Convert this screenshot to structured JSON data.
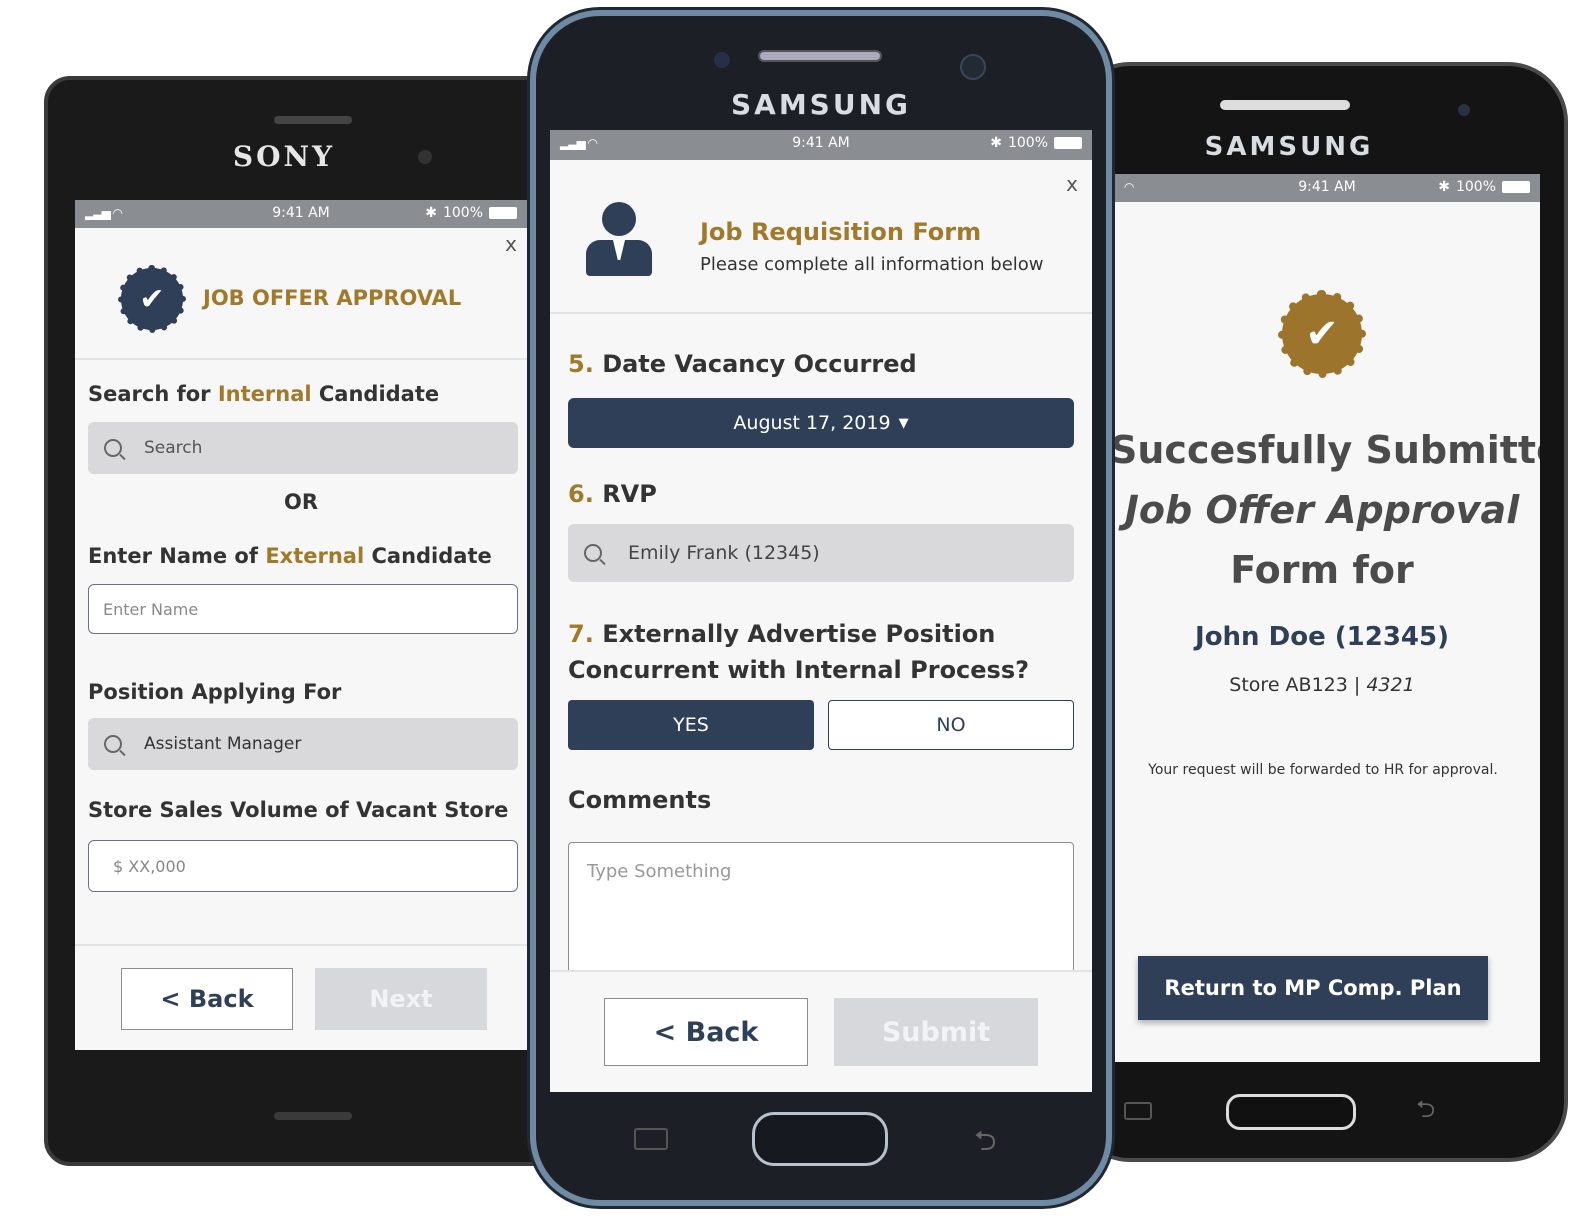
{
  "left": {
    "brand": "SONY",
    "status": {
      "time": "9:41 AM",
      "battery": "100%"
    },
    "close": "x",
    "title": "JOB OFFER APPROVAL",
    "search_label": {
      "pre": "Search for ",
      "highlight": "Internal",
      "post": " Candidate"
    },
    "search_placeholder": "Search",
    "or": "OR",
    "external_label": {
      "pre": "Enter Name of ",
      "highlight": "External",
      "post": " Candidate"
    },
    "name_placeholder": "Enter Name",
    "position_label": "Position Applying For",
    "position_value": "Assistant Manager",
    "sales_label": "Store Sales Volume of Vacant Store",
    "sales_placeholder": "$ XX,000",
    "back": "< Back",
    "next": "Next"
  },
  "middle": {
    "brand": "SAMSUNG",
    "status": {
      "time": "9:41 AM",
      "battery": "100%"
    },
    "close": "x",
    "title": "Job Requisition Form",
    "subtitle": "Please complete all information below",
    "q5": {
      "num": "5.",
      "text": "Date Vacancy Occurred"
    },
    "date_value": "August 17, 2019",
    "q6": {
      "num": "6.",
      "text": "RVP"
    },
    "rvp_value": "Emily Frank (12345)",
    "q7": {
      "num": "7.",
      "text_line1": "Externally Advertise Position",
      "text_line2": "Concurrent with Internal Process?"
    },
    "yes": "YES",
    "no": "NO",
    "comments_label": "Comments",
    "comments_placeholder": "Type Something",
    "back": "< Back",
    "submit": "Submit"
  },
  "right": {
    "brand": "SAMSUNG",
    "status": {
      "time": "9:41 AM",
      "battery": "100%"
    },
    "line1": "Succesfully Submitted",
    "line2": "Job Offer Approval",
    "line3": "Form for",
    "name": "John Doe (12345)",
    "store_prefix": "Store AB123 | ",
    "store_num": "4321",
    "note": "Your request will be forwarded to HR for approval.",
    "return_button": "Return to MP Comp. Plan"
  },
  "colors": {
    "navy": "#2f3f58",
    "gold": "#a07a2a",
    "gray_field": "#d9d9db"
  }
}
